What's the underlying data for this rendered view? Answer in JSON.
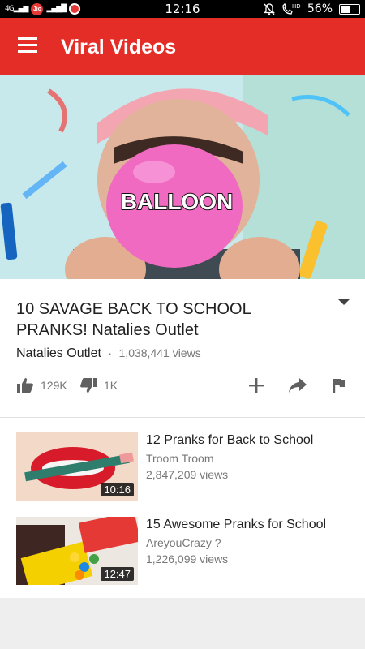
{
  "status_bar": {
    "time": "12:16",
    "carrier_badge": "Jio",
    "battery_percent": "56%",
    "battery_level": 0.56,
    "icons": [
      "network-4g-signal-icon",
      "jio-icon",
      "signal-bars-icon",
      "vodafone-icon",
      "bell-muted-icon",
      "hd-call-icon",
      "battery-icon"
    ]
  },
  "app_bar": {
    "title": "Viral Videos",
    "menu_icon": "hamburger-menu-icon",
    "color": "#e52d27"
  },
  "player": {
    "overlay_text": "BALLOON"
  },
  "video": {
    "title": "10 SAVAGE BACK TO SCHOOL PRANKS! Natalies Outlet",
    "channel": "Natalies Outlet",
    "separator": "·",
    "views": "1,038,441 views",
    "likes": "129K",
    "dislikes": "1K",
    "action_icons": [
      "thumbs-up-icon",
      "thumbs-down-icon",
      "add-icon",
      "share-icon",
      "flag-icon"
    ]
  },
  "related": [
    {
      "title": "12 Pranks for Back to School",
      "channel": "Troom Troom",
      "views": "2,847,209 views",
      "duration": "10:16"
    },
    {
      "title": "15 Awesome Pranks for School",
      "channel": "AreyouCrazy ?",
      "views": "1,226,099 views",
      "duration": "12:47"
    }
  ]
}
